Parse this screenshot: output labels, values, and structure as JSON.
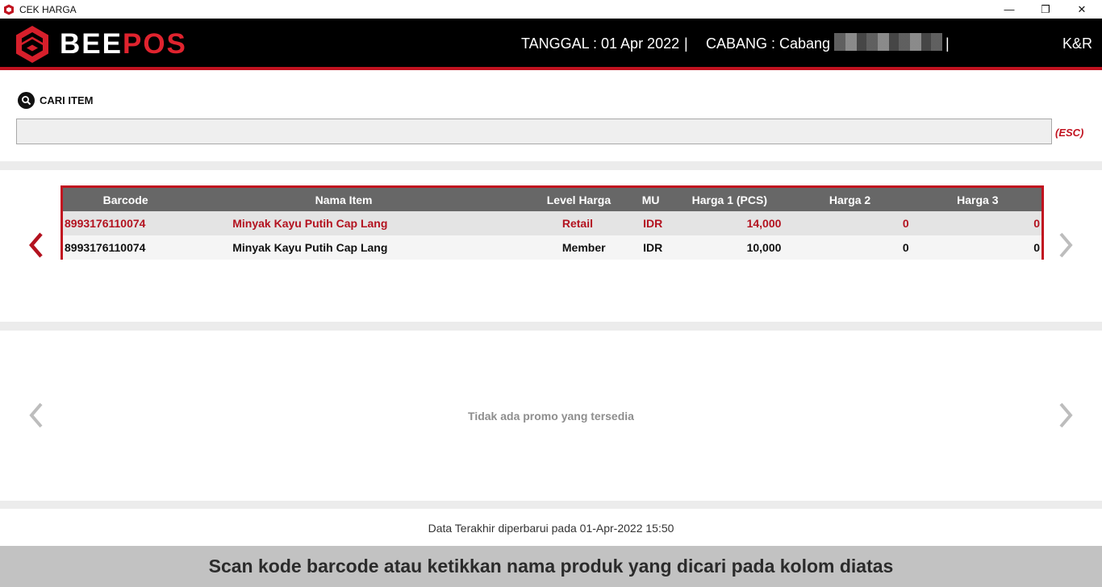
{
  "window": {
    "title": "CEK HARGA",
    "min_glyph": "—",
    "max_glyph": "❐",
    "close_glyph": "✕"
  },
  "header": {
    "logo_part1": "BEE",
    "logo_part2": "POS",
    "date_text": "TANGGAL : 01 Apr 2022",
    "separator": "|",
    "branch_text": "CABANG : Cabang",
    "user": "K&R",
    "colors": {
      "accent": "#c1121f",
      "logo_red": "#e0232e"
    }
  },
  "search": {
    "label": "CARI ITEM",
    "value": "",
    "esc_hint": "(ESC)"
  },
  "price_table": {
    "columns": [
      "Barcode",
      "Nama Item",
      "Level Harga",
      "MU",
      "Harga 1 (PCS)",
      "Harga 2",
      "Harga 3"
    ],
    "rows": [
      [
        "8993176110074",
        "Minyak Kayu Putih Cap Lang",
        "Retail",
        "IDR",
        "14,000",
        "0",
        "0"
      ],
      [
        "8993176110074",
        "Minyak Kayu Putih Cap Lang",
        "Member",
        "IDR",
        "10,000",
        "0",
        "0"
      ]
    ]
  },
  "promo": {
    "empty_text": "Tidak ada promo yang tersedia"
  },
  "status": {
    "updated_text": "Data Terakhir diperbarui pada 01-Apr-2022 15:50"
  },
  "footer": {
    "message": "Scan kode barcode atau ketikkan nama produk yang dicari pada kolom diatas"
  }
}
